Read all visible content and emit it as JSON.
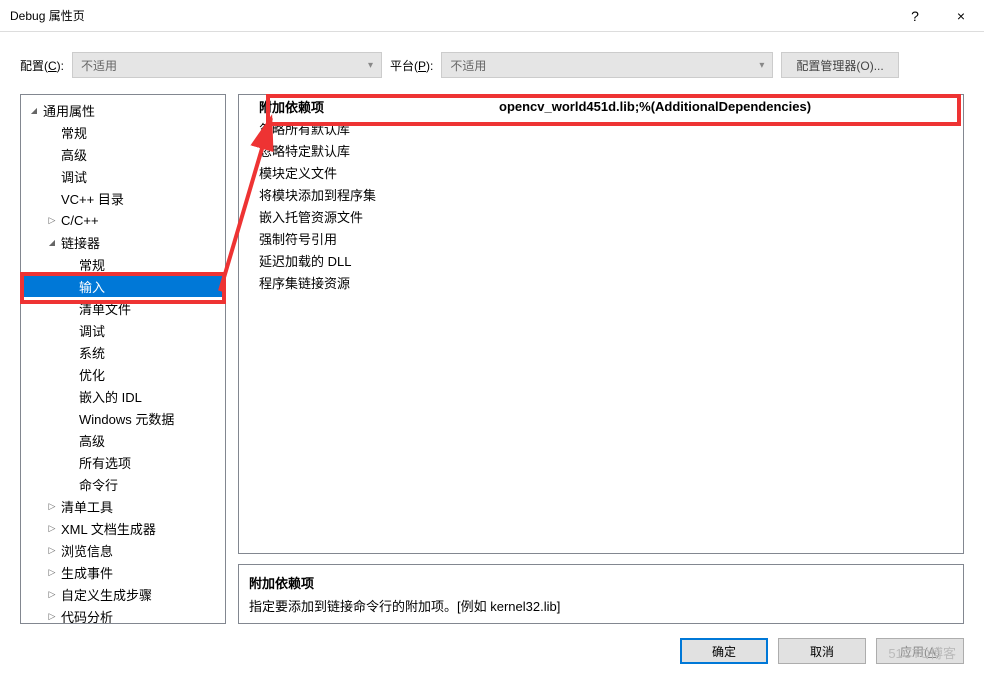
{
  "titlebar": {
    "title": "Debug 属性页",
    "help": "?",
    "close": "×"
  },
  "config": {
    "config_label": "配置(C):",
    "config_value": "不适用",
    "platform_label": "平台(P):",
    "platform_value": "不适用",
    "manager_label": "配置管理器(O)..."
  },
  "tree": [
    {
      "label": "通用属性",
      "indent": 0,
      "arrow": "expanded"
    },
    {
      "label": "常规",
      "indent": 1,
      "arrow": "none"
    },
    {
      "label": "高级",
      "indent": 1,
      "arrow": "none"
    },
    {
      "label": "调试",
      "indent": 1,
      "arrow": "none"
    },
    {
      "label": "VC++ 目录",
      "indent": 1,
      "arrow": "none"
    },
    {
      "label": "C/C++",
      "indent": 1,
      "arrow": "collapsed"
    },
    {
      "label": "链接器",
      "indent": 1,
      "arrow": "expanded"
    },
    {
      "label": "常规",
      "indent": 2,
      "arrow": "none"
    },
    {
      "label": "输入",
      "indent": 2,
      "arrow": "none",
      "selected": true
    },
    {
      "label": "清单文件",
      "indent": 2,
      "arrow": "none"
    },
    {
      "label": "调试",
      "indent": 2,
      "arrow": "none"
    },
    {
      "label": "系统",
      "indent": 2,
      "arrow": "none"
    },
    {
      "label": "优化",
      "indent": 2,
      "arrow": "none"
    },
    {
      "label": "嵌入的 IDL",
      "indent": 2,
      "arrow": "none"
    },
    {
      "label": "Windows 元数据",
      "indent": 2,
      "arrow": "none"
    },
    {
      "label": "高级",
      "indent": 2,
      "arrow": "none"
    },
    {
      "label": "所有选项",
      "indent": 2,
      "arrow": "none"
    },
    {
      "label": "命令行",
      "indent": 2,
      "arrow": "none"
    },
    {
      "label": "清单工具",
      "indent": 1,
      "arrow": "collapsed"
    },
    {
      "label": "XML 文档生成器",
      "indent": 1,
      "arrow": "collapsed"
    },
    {
      "label": "浏览信息",
      "indent": 1,
      "arrow": "collapsed"
    },
    {
      "label": "生成事件",
      "indent": 1,
      "arrow": "collapsed"
    },
    {
      "label": "自定义生成步骤",
      "indent": 1,
      "arrow": "collapsed"
    },
    {
      "label": "代码分析",
      "indent": 1,
      "arrow": "collapsed"
    }
  ],
  "properties": [
    {
      "name": "附加依赖项",
      "value": "opencv_world451d.lib;%(AdditionalDependencies)",
      "bold": true
    },
    {
      "name": "忽略所有默认库",
      "value": ""
    },
    {
      "name": "忽略特定默认库",
      "value": ""
    },
    {
      "name": "模块定义文件",
      "value": ""
    },
    {
      "name": "将模块添加到程序集",
      "value": ""
    },
    {
      "name": "嵌入托管资源文件",
      "value": ""
    },
    {
      "name": "强制符号引用",
      "value": ""
    },
    {
      "name": "延迟加载的 DLL",
      "value": ""
    },
    {
      "name": "程序集链接资源",
      "value": ""
    }
  ],
  "description": {
    "title": "附加依赖项",
    "text": "指定要添加到链接命令行的附加项。[例如 kernel32.lib]"
  },
  "buttons": {
    "ok": "确定",
    "cancel": "取消",
    "apply": "应用(A)"
  },
  "watermark": "51CTO博客"
}
